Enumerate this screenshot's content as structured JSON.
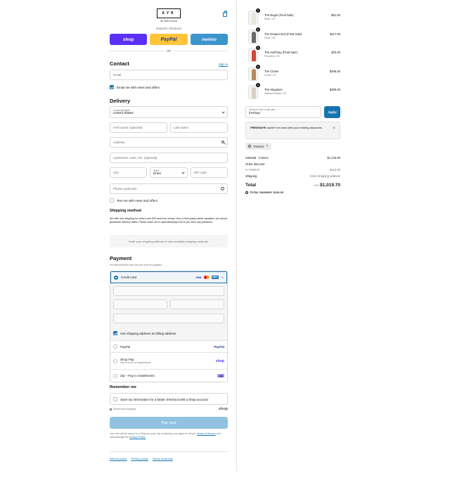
{
  "header": {
    "logo_text": "AYR",
    "logo_sub": "All Year Round",
    "express_label": "Express checkout",
    "express_buttons": {
      "shop": "shop",
      "paypal": "PayPal",
      "venmo": "venmo"
    },
    "or_label": "OR"
  },
  "contact": {
    "title": "Contact",
    "sign_in": "Sign in",
    "email_placeholder": "Email",
    "email_news_label": "Email me with news and offers",
    "email_news_checked": true
  },
  "delivery": {
    "title": "Delivery",
    "country_label": "Country/Region",
    "country_value": "United States",
    "first_name_placeholder": "First name (optional)",
    "last_name_placeholder": "Last name",
    "address_placeholder": "Address",
    "apartment_placeholder": "Apartment, suite, etc. (optional)",
    "city_placeholder": "City",
    "state_label": "State",
    "state_value": "Enes",
    "zip_placeholder": "ZIP code",
    "phone_placeholder": "Phone (optional)",
    "text_news_label": "Text me with news and offers"
  },
  "shipping": {
    "title": "Shipping method",
    "note": "We offer free shipping for orders over $75 and free returns. Due to third party carrier variables, we cannot guarantee delivery dates. Please reach out to ayrheads@ayr.com if you have any questions.",
    "placeholder": "Enter your shipping address to view available shipping methods."
  },
  "payment": {
    "title": "Payment",
    "subtitle": "All transactions are secure and encrypted.",
    "credit_card_label": "Credit card",
    "card_logos": {
      "visa": "VISA",
      "amex": "AMEX",
      "more": "+1"
    },
    "billing_same_label": "Use shipping address as billing address",
    "paypal_label": "PayPal",
    "paypal_logo": "PayPal",
    "shoppay_label": "Shop Pay",
    "shoppay_sub": "Pay in full or in installments",
    "shoppay_logo": "shop",
    "zip_label": "Zip – Pay in installments",
    "zip_logo": "zip"
  },
  "remember": {
    "title": "Remember me",
    "save_label": "Save my information for a faster checkout with a Shop account",
    "secure_label": "Secure and encrypted",
    "shop_word": "shop"
  },
  "pay_now": "Pay now",
  "legal": {
    "text": "Your info will be saved to a Shop account. By continuing, you agree to Shop's",
    "terms_link": "Terms of Service",
    "and_text": "and acknowledge the",
    "privacy_link": "Privacy Policy."
  },
  "footer_links": [
    "Refund policy",
    "Privacy policy",
    "Terms of service"
  ],
  "cart": {
    "items": [
      {
        "name": "The Bogie (Final Sale)",
        "variant": "White / XS",
        "price": "$51.00",
        "qty": "1",
        "color": "#e9e6de"
      },
      {
        "name": "The Deeper End (Final Sale)",
        "variant": "Shore / XS",
        "price": "$117.00",
        "qty": "1",
        "color": "#6c6a67"
      },
      {
        "name": "The Half Day (Final Sale)",
        "variant": "Pomodoro / XS",
        "price": "$75.00",
        "qty": "1",
        "color": "#d2453a"
      },
      {
        "name": "The Closer",
        "variant": "Camel / XS",
        "price": "$495.00",
        "qty": "1",
        "color": "#b98a5a"
      },
      {
        "name": "The Megalure",
        "variant": "Oatmeal Heather / XS",
        "price": "$395.00",
        "qty": "1",
        "color": "#d8d0c2"
      }
    ],
    "discount_label": "Discount code or gift card",
    "discount_value": "freshayr",
    "apply_label": "Apply",
    "error_code": "FRESHAYR",
    "error_text": "couldn't be used with your existing discounts.",
    "applied_tag": "TAKE10",
    "subtotal_label": "Subtotal · 5 items",
    "subtotal_value": "$1,133.00",
    "order_discount_label": "Order discount",
    "order_discount_code": "TAKE10",
    "order_discount_value": "- $113.30",
    "shipping_label": "Shipping",
    "shipping_value": "Enter shipping address",
    "total_label": "Total",
    "total_currency": "USD",
    "total_value": "$1,019.70",
    "savings_label": "TOTAL SAVINGS",
    "savings_value": "$113.30"
  }
}
